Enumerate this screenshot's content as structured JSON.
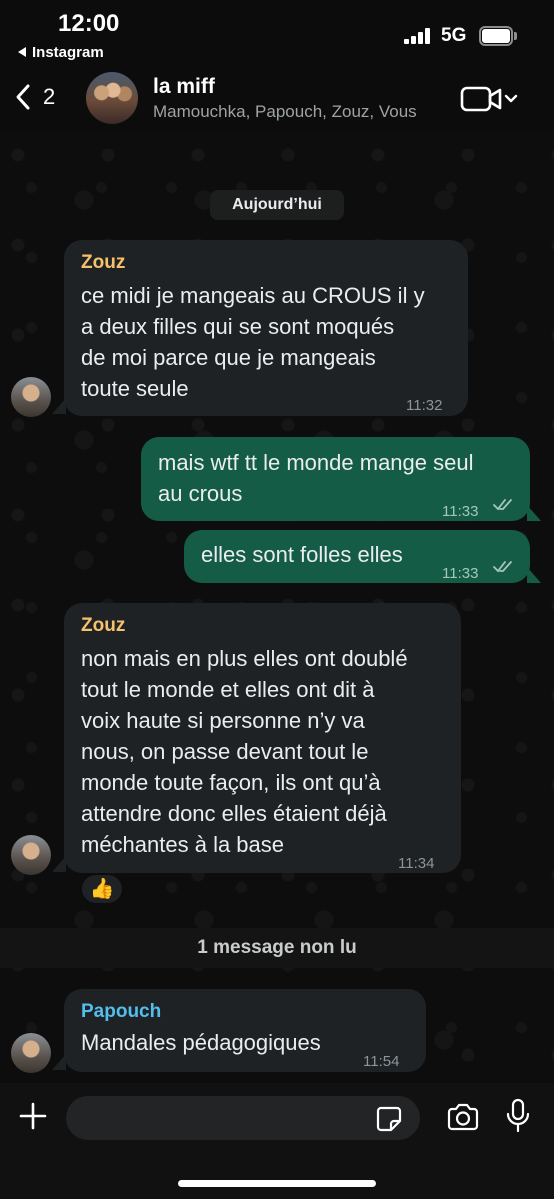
{
  "status_bar": {
    "time": "12:00",
    "back_app": "Instagram",
    "network": "5G"
  },
  "header": {
    "back_count": "2",
    "group_name": "la miff",
    "members": "Mamouchka, Papouch, Zouz, Vous"
  },
  "date_separator": "Aujourd’hui",
  "messages": [
    {
      "direction": "in",
      "sender": "Zouz",
      "sender_color": "#f5c16c",
      "lines": [
        "ce midi je mangeais au CROUS il y",
        "a deux filles qui se sont moqués",
        "de moi parce que je mangeais",
        "toute seule"
      ],
      "time": "11:32"
    },
    {
      "direction": "out",
      "lines": [
        "mais wtf tt le monde mange seul",
        "au crous"
      ],
      "time": "11:33",
      "status": "read"
    },
    {
      "direction": "out",
      "lines": [
        "elles sont folles elles"
      ],
      "time": "11:33",
      "status": "read"
    },
    {
      "direction": "in",
      "sender": "Zouz",
      "sender_color": "#f5c16c",
      "lines": [
        "non mais en plus elles ont doublé",
        "tout le monde et elles ont dit à",
        "voix haute si personne n’y va",
        "nous, on passe devant tout le",
        "monde toute façon, ils ont qu’à",
        "attendre donc elles étaient déjà",
        "méchantes à la base"
      ],
      "time": "11:34",
      "reaction": "👍"
    },
    {
      "direction": "in",
      "sender": "Papouch",
      "sender_color": "#53bdeb",
      "lines": [
        "Mandales pédagogiques"
      ],
      "time": "11:54"
    }
  ],
  "unread_banner": "1 message non lu",
  "input": {
    "value": "",
    "placeholder": ""
  },
  "icons": {
    "back": "chevron-left-icon",
    "video": "video-camera-icon",
    "attach": "plus-icon",
    "sticker": "sticker-icon",
    "camera": "camera-icon",
    "mic": "microphone-icon"
  },
  "colors": {
    "incoming_bubble": "#1f2224",
    "outgoing_bubble": "#155c47",
    "read_ticks": "#a4c7bb"
  }
}
